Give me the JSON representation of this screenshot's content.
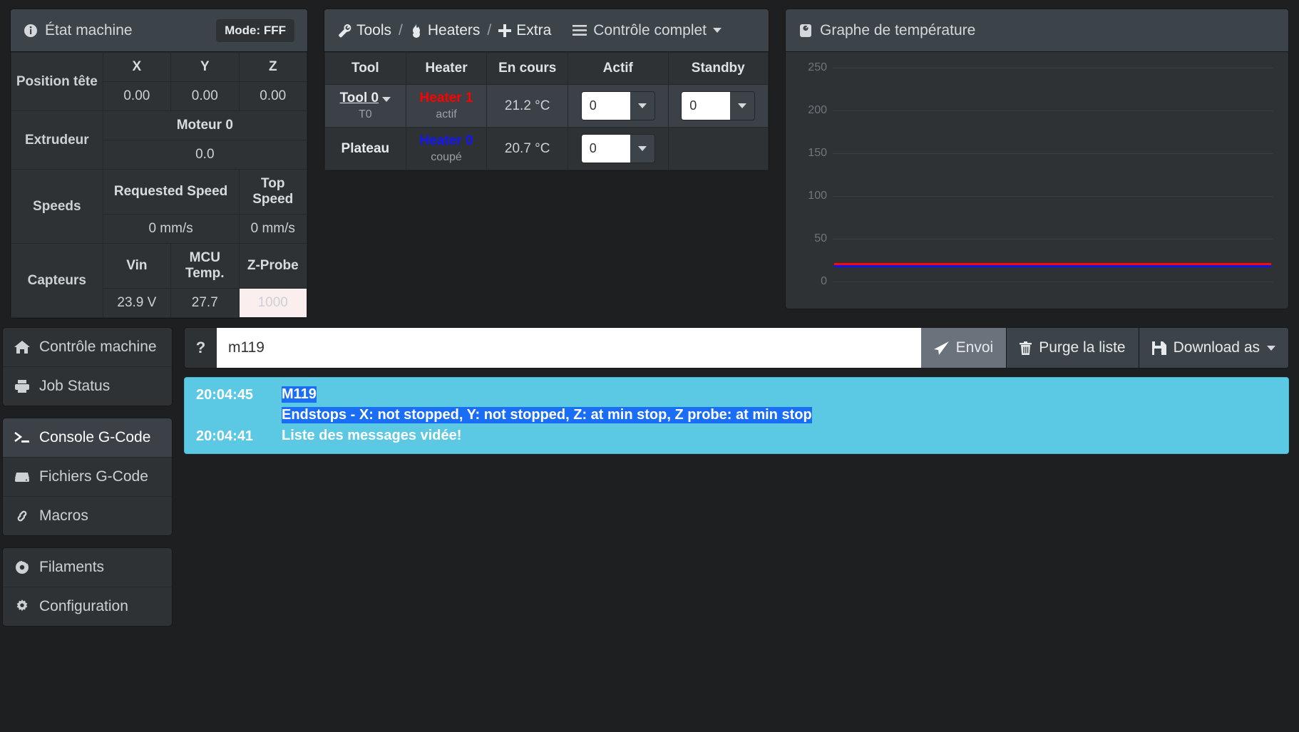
{
  "machine_status": {
    "title": "État machine",
    "icon": "info-circle-icon",
    "mode_badge": "Mode: FFF",
    "head_position": {
      "label": "Position tête",
      "columns": [
        "X",
        "Y",
        "Z"
      ],
      "values": [
        "0.00",
        "0.00",
        "0.00"
      ]
    },
    "extruder": {
      "label": "Extrudeur",
      "columns": [
        "Moteur 0"
      ],
      "values": [
        "0.0"
      ]
    },
    "speeds": {
      "label": "Speeds",
      "columns": [
        "Requested Speed",
        "Top Speed"
      ],
      "values": [
        "0 mm/s",
        "0 mm/s"
      ]
    },
    "sensors": {
      "label": "Capteurs",
      "columns": [
        "Vin",
        "MCU Temp.",
        "Z-Probe"
      ],
      "values": [
        "23.9 V",
        "27.7",
        "1000"
      ]
    }
  },
  "tools_panel": {
    "nav": {
      "tools": "Tools",
      "heaters": "Heaters",
      "extra": "Extra",
      "separator": "/",
      "full_control": "Contrôle complet"
    },
    "columns": [
      "Tool",
      "Heater",
      "En cours",
      "Actif",
      "Standby"
    ],
    "rows": [
      {
        "tool": "Tool 0",
        "tool_sub": "T0",
        "heater": "Heater 1",
        "heater_color": "#ff0000",
        "heater_state": "actif",
        "current": "21.2 °C",
        "active": "0",
        "standby": "0",
        "selected": true
      },
      {
        "tool": "Plateau",
        "tool_sub": "",
        "heater": "Heater 0",
        "heater_color": "#1414ff",
        "heater_state": "coupé",
        "current": "20.7 °C",
        "active": "0",
        "standby": "",
        "selected": false
      }
    ]
  },
  "graph_panel": {
    "title": "Graphe de température",
    "icon": "chart-icon"
  },
  "chart_data": {
    "type": "line",
    "title": "Graphe de température",
    "xlabel": "",
    "ylabel": "",
    "ylim": [
      0,
      275
    ],
    "yticks": [
      0,
      50,
      100,
      150,
      200,
      250
    ],
    "grid": true,
    "legend": "none",
    "series": [
      {
        "name": "Heater 1",
        "color": "#fa0a0a",
        "value": 21.2,
        "values": [
          21.2,
          21.2,
          21.2,
          21.2,
          21.2,
          21.2,
          21.2,
          21.2,
          21.2,
          21.2
        ]
      },
      {
        "name": "Heater 0",
        "color": "#1414e6",
        "value": 20.7,
        "values": [
          20.7,
          20.7,
          20.7,
          20.7,
          20.7,
          20.7,
          20.7,
          20.7,
          20.7,
          20.7
        ]
      }
    ]
  },
  "sidebar": {
    "groups": [
      {
        "items": [
          {
            "label": "Contrôle machine",
            "icon": "home-icon",
            "active": false
          },
          {
            "label": "Job Status",
            "icon": "printer-icon",
            "active": false
          }
        ]
      },
      {
        "items": [
          {
            "label": "Console G-Code",
            "icon": "terminal-icon",
            "active": true
          },
          {
            "label": "Fichiers G-Code",
            "icon": "drive-icon",
            "active": false
          },
          {
            "label": "Macros",
            "icon": "link-icon",
            "active": false
          }
        ]
      },
      {
        "items": [
          {
            "label": "Filaments",
            "icon": "spool-icon",
            "active": false
          },
          {
            "label": "Configuration",
            "icon": "gear-icon",
            "active": false
          }
        ]
      }
    ]
  },
  "console": {
    "help_label": "?",
    "command_value": "m119",
    "command_placeholder": "",
    "send_label": "Envoi",
    "clear_label": "Purge la liste",
    "download_label": "Download as",
    "log_entries": [
      {
        "time": "20:04:45",
        "messages": [
          {
            "text": "M119",
            "selected": true
          },
          {
            "text": "Endstops - X: not stopped, Y: not stopped, Z: at min stop, Z probe: at min stop",
            "selected": true
          }
        ]
      },
      {
        "time": "20:04:41",
        "messages": [
          {
            "text": "Liste des messages vidée!",
            "selected": false
          }
        ]
      }
    ]
  }
}
